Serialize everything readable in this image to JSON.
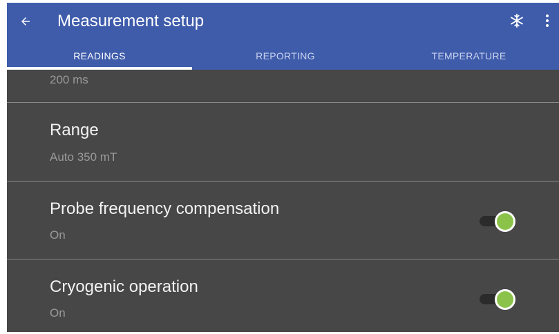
{
  "appbar": {
    "title": "Measurement setup",
    "back_icon": "arrow-left-icon",
    "freeze_icon": "snowflake-icon",
    "more_icon": "more-vertical-icon",
    "color": "#3f5cab"
  },
  "tabs": [
    {
      "label": "READINGS",
      "active": true
    },
    {
      "label": "REPORTING",
      "active": false
    },
    {
      "label": "TEMPERATURE",
      "active": false
    }
  ],
  "settings": {
    "partial_row": {
      "value": "200 ms"
    },
    "range": {
      "title": "Range",
      "value": "Auto 350 mT"
    },
    "probe_frequency_compensation": {
      "title": "Probe frequency compensation",
      "value": "On",
      "enabled": true
    },
    "cryogenic_operation": {
      "title": "Cryogenic operation",
      "value": "On",
      "enabled": true
    }
  },
  "colors": {
    "background": "#474747",
    "switch_on": "#8bc34a"
  }
}
